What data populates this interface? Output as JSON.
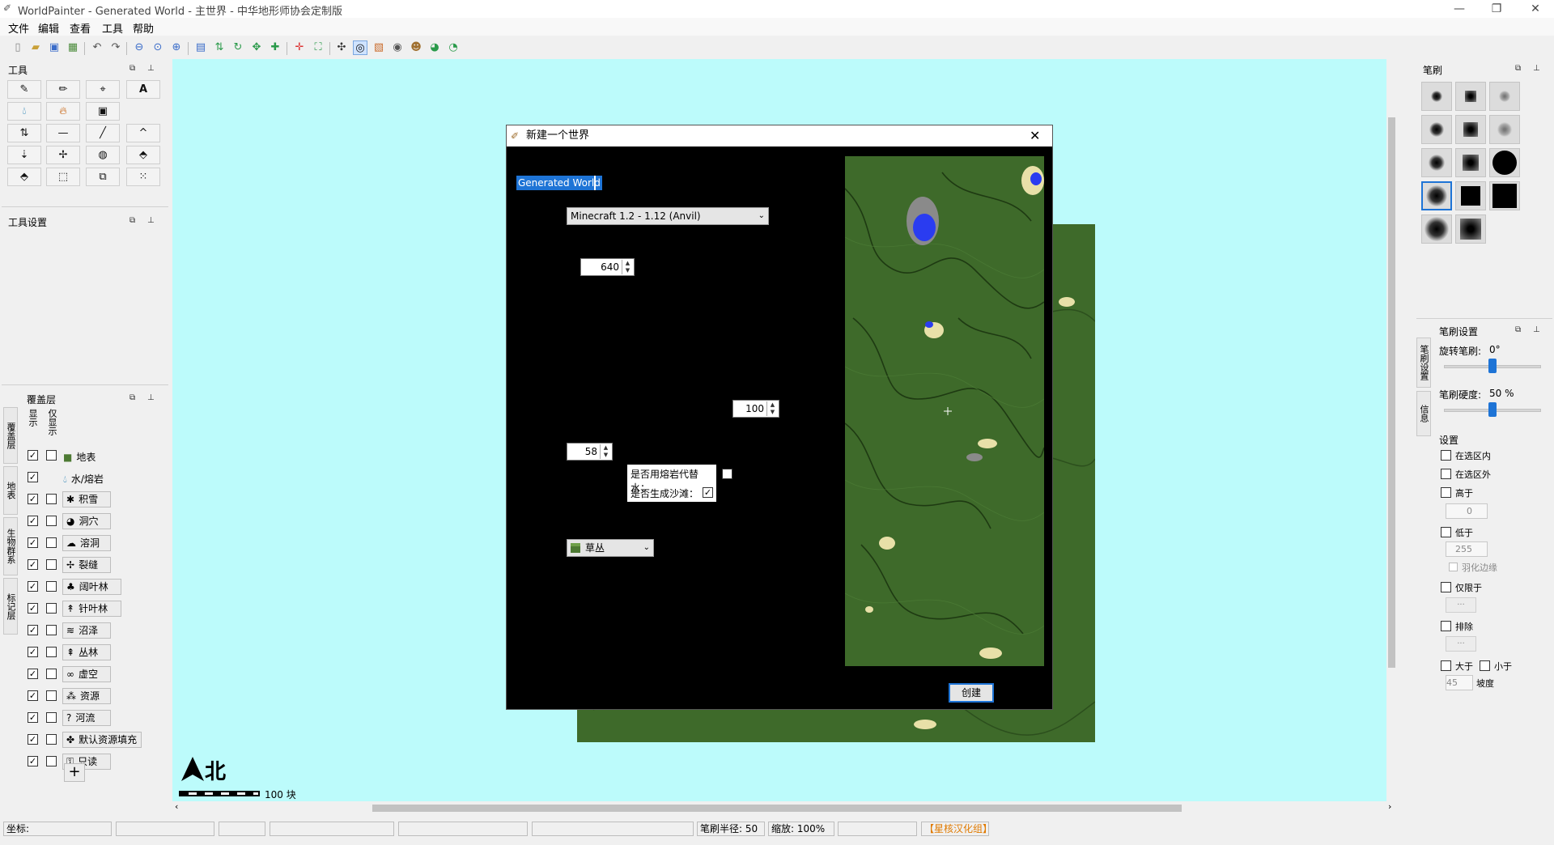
{
  "window": {
    "title": "WorldPainter - Generated World - 主世界 - 中华地形师协会定制版"
  },
  "menu": [
    "文件",
    "编辑",
    "查看",
    "工具",
    "帮助"
  ],
  "panels": {
    "tools_title": "工具",
    "tool_settings_title": "工具设置",
    "layers_title": "覆盖层",
    "brushes_title": "笔刷",
    "brush_settings_title": "笔刷设置"
  },
  "layers": {
    "col_show": "显示",
    "col_solo": "仅显示",
    "side_tabs": [
      "覆盖层",
      "地表",
      "生物群系",
      "标记层"
    ],
    "items": [
      {
        "name": "地表",
        "icon": "grass-block-icon",
        "show": true,
        "solo": false
      },
      {
        "name": "水/熔岩",
        "icon": "water-drop-icon",
        "show": true,
        "solo": null
      },
      {
        "name": "积雪",
        "icon": "snowflake-icon",
        "show": true,
        "solo": false
      },
      {
        "name": "洞穴",
        "icon": "cave-icon",
        "show": true,
        "solo": false
      },
      {
        "name": "溶洞",
        "icon": "cavern-icon",
        "show": true,
        "solo": false
      },
      {
        "name": "裂缝",
        "icon": "chasm-icon",
        "show": true,
        "solo": false
      },
      {
        "name": "阔叶林",
        "icon": "deciduous-tree-icon",
        "show": true,
        "solo": false
      },
      {
        "name": "针叶林",
        "icon": "pine-tree-icon",
        "show": true,
        "solo": false
      },
      {
        "name": "沼泽",
        "icon": "swamp-icon",
        "show": true,
        "solo": false
      },
      {
        "name": "丛林",
        "icon": "jungle-icon",
        "show": true,
        "solo": false
      },
      {
        "name": "虚空",
        "icon": "infinity-icon",
        "show": true,
        "solo": false
      },
      {
        "name": "资源",
        "icon": "resources-icon",
        "show": true,
        "solo": false
      },
      {
        "name": "河流",
        "icon": "question-icon",
        "show": true,
        "solo": false
      },
      {
        "name": "默认资源填充",
        "icon": "resources-fill-icon",
        "show": true,
        "solo": false
      },
      {
        "name": "只读",
        "icon": "lock-icon",
        "show": true,
        "solo": false
      }
    ],
    "add_label": "+"
  },
  "canvas": {
    "compass_label": "北",
    "scale_label": "100 块"
  },
  "dialog": {
    "title": "新建一个世界",
    "world_name": "Generated World",
    "version": "Minecraft 1.2 - 1.12 (Anvil)",
    "size": "640",
    "height_value": "100",
    "water_level": "58",
    "lava_label": "是否用熔岩代替水：",
    "lava_checked": false,
    "beach_label": "是否生成沙滩：",
    "beach_checked": true,
    "terrain": "草丛",
    "create_label": "创建"
  },
  "brush_settings": {
    "side_tabs": [
      "笔刷设置",
      "信息"
    ],
    "rotation_label": "旋转笔刷:",
    "rotation_value": "0°",
    "rotation_fraction": 0.5,
    "hardness_label": "笔刷硬度:",
    "hardness_value": "50 %",
    "hardness_fraction": 0.5,
    "settings_label": "设置",
    "inside_selection": "在选区内",
    "outside_selection": "在选区外",
    "above_label": "高于",
    "above_value": "0",
    "below_label": "低于",
    "below_value": "255",
    "feather_label": "羽化边缘",
    "only_on_label": "仅限于",
    "only_on_value": "...",
    "exclude_label": "排除",
    "exclude_value": "...",
    "greater_label": "大于",
    "less_label": "小于",
    "slope_value": "45",
    "slope_label": "坡度"
  },
  "status": {
    "coords_label": "坐标:",
    "brush_radius": "笔刷半径: 50",
    "zoom": "缩放: 100%",
    "credit": "【星核汉化组】",
    "credit_color": "#e07a00"
  },
  "colors": {
    "canvas_bg": "#bcfbfb",
    "terrain_green": "#3e6a2a",
    "water_blue": "#2a3cf0",
    "sand": "#e8e0a8",
    "accent_blue": "#1e74d6"
  }
}
